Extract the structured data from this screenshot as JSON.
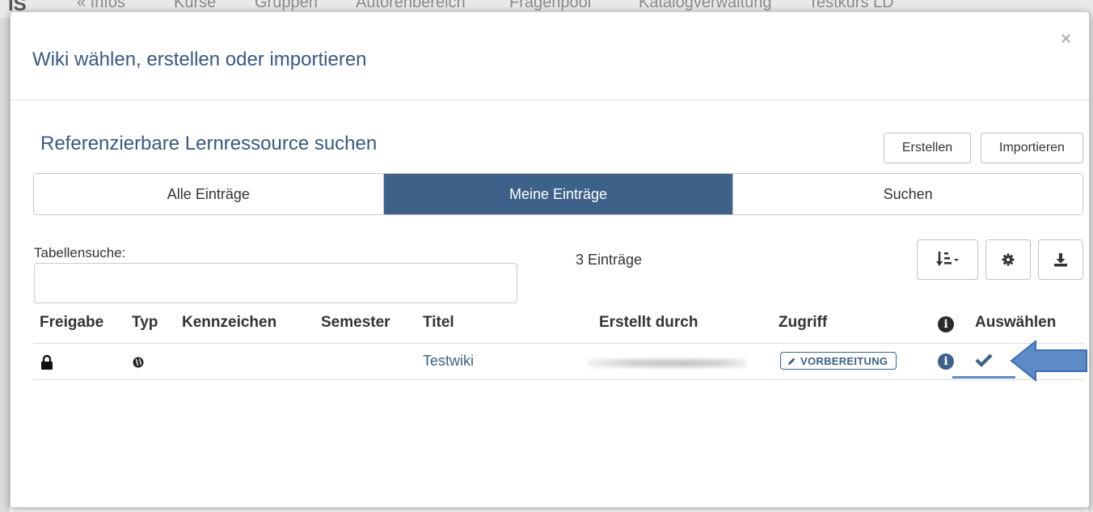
{
  "background_nav": {
    "logo": "IS",
    "items": [
      "« Infos",
      "Kurse",
      "Gruppen",
      "Autorenbereich",
      "Fragenpool",
      "Katalogverwaltung",
      "Testkurs LD"
    ]
  },
  "modal": {
    "title": "Wiki wählen, erstellen oder importieren",
    "close_symbol": "×",
    "section_title": "Referenzierbare Lernressource suchen",
    "buttons": {
      "create": "Erstellen",
      "import": "Importieren"
    },
    "tabs": [
      {
        "label": "Alle Einträge",
        "active": false
      },
      {
        "label": "Meine Einträge",
        "active": true
      },
      {
        "label": "Suchen",
        "active": false
      }
    ],
    "search": {
      "label": "Tabellensuche:",
      "value": "",
      "placeholder": ""
    },
    "entry_count": "3 Einträge",
    "toolbar_icons": [
      "sort-icon",
      "gear-icon",
      "download-icon"
    ],
    "table": {
      "headers": {
        "release": "Freigabe",
        "type": "Typ",
        "identifier": "Kennzeichen",
        "semester": "Semester",
        "title": "Titel",
        "created_by": "Erstellt durch",
        "access": "Zugriff",
        "info_icon": "info-icon",
        "select": "Auswählen"
      },
      "rows": [
        {
          "release_icon": "lock-icon",
          "type_icon": "globe-icon",
          "identifier": "",
          "semester": "",
          "title": "Testwiki",
          "created_by": "",
          "access_badge": "VORBEREITUNG",
          "select_icon": "check-icon"
        }
      ]
    }
  },
  "colors": {
    "brand": "#3d6189",
    "title_blue": "#39597f",
    "annotation_arrow": "#5d8bc7"
  }
}
